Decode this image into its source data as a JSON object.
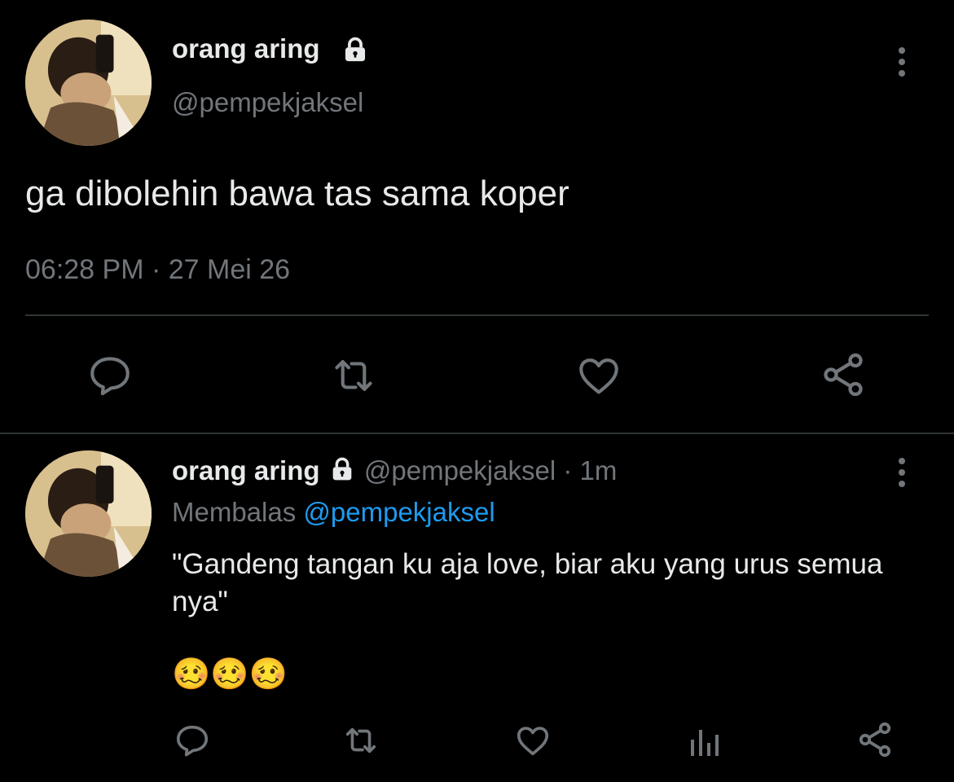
{
  "main_tweet": {
    "display_name": "orang aring",
    "handle": "@pempekjaksel",
    "text": "ga dibolehin bawa tas sama koper",
    "timestamp": "06:28 PM · 27 Mei 26",
    "actions": [
      "reply-icon",
      "retweet-icon",
      "like-icon",
      "share-icon"
    ]
  },
  "reply_tweet": {
    "display_name": "orang aring",
    "handle": "@pempekjaksel",
    "separator": "·",
    "age": "1m",
    "replying_prefix": "Membalas",
    "replying_to": "@pempekjaksel",
    "text": "\"Gandeng tangan ku aja love, biar aku yang urus semua nya\"",
    "emojis": [
      "🥴",
      "🥴",
      "🥴"
    ],
    "actions": [
      "reply-icon",
      "retweet-icon",
      "like-icon",
      "analytics-icon",
      "share-icon"
    ]
  },
  "colors": {
    "background": "#000000",
    "text_primary": "#e7e9ea",
    "text_secondary": "#71767b",
    "link": "#1d9bf0",
    "divider": "#2f3336"
  }
}
